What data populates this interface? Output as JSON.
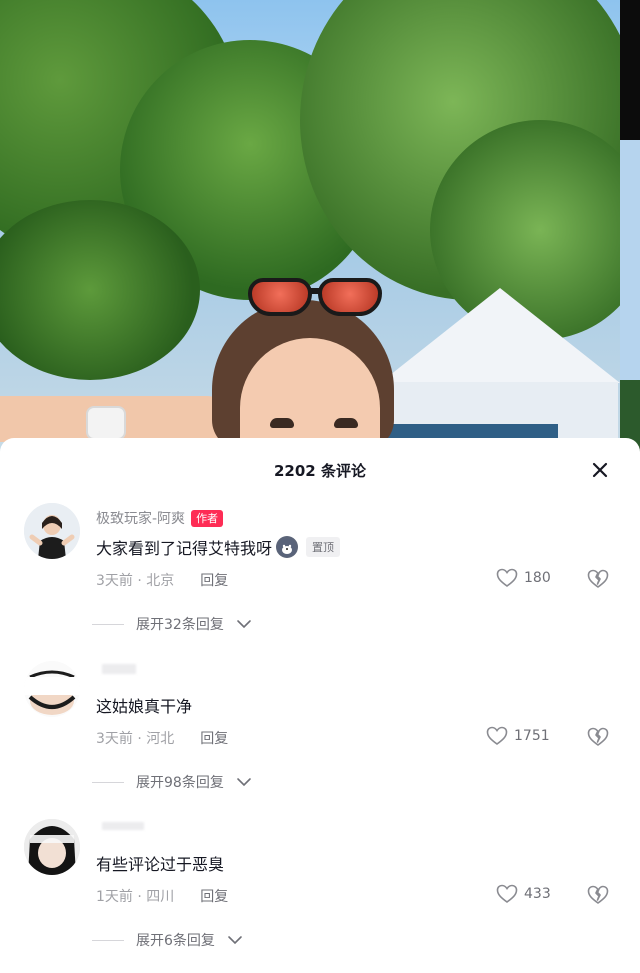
{
  "panel": {
    "title": "2202 条评论",
    "close_icon": "close-icon"
  },
  "comments": [
    {
      "username": "极致玩家-阿爽",
      "author_badge": "作者",
      "text": "大家看到了记得艾特我呀",
      "pin_badge": "置顶",
      "time": "3天前 · 北京",
      "reply_label": "回复",
      "likes": "180",
      "expand_label": "展开32条回复"
    },
    {
      "username": "",
      "text": "这姑娘真干净",
      "time": "3天前 · 河北",
      "reply_label": "回复",
      "likes": "1751",
      "expand_label": "展开98条回复"
    },
    {
      "username": "",
      "text": "有些评论过于恶臭",
      "time": "1天前 · 四川",
      "reply_label": "回复",
      "likes": "433",
      "expand_label": "展开6条回复"
    }
  ],
  "colors": {
    "accent": "#fe2c55",
    "text_primary": "#161823",
    "text_secondary": "#8a8b91"
  }
}
